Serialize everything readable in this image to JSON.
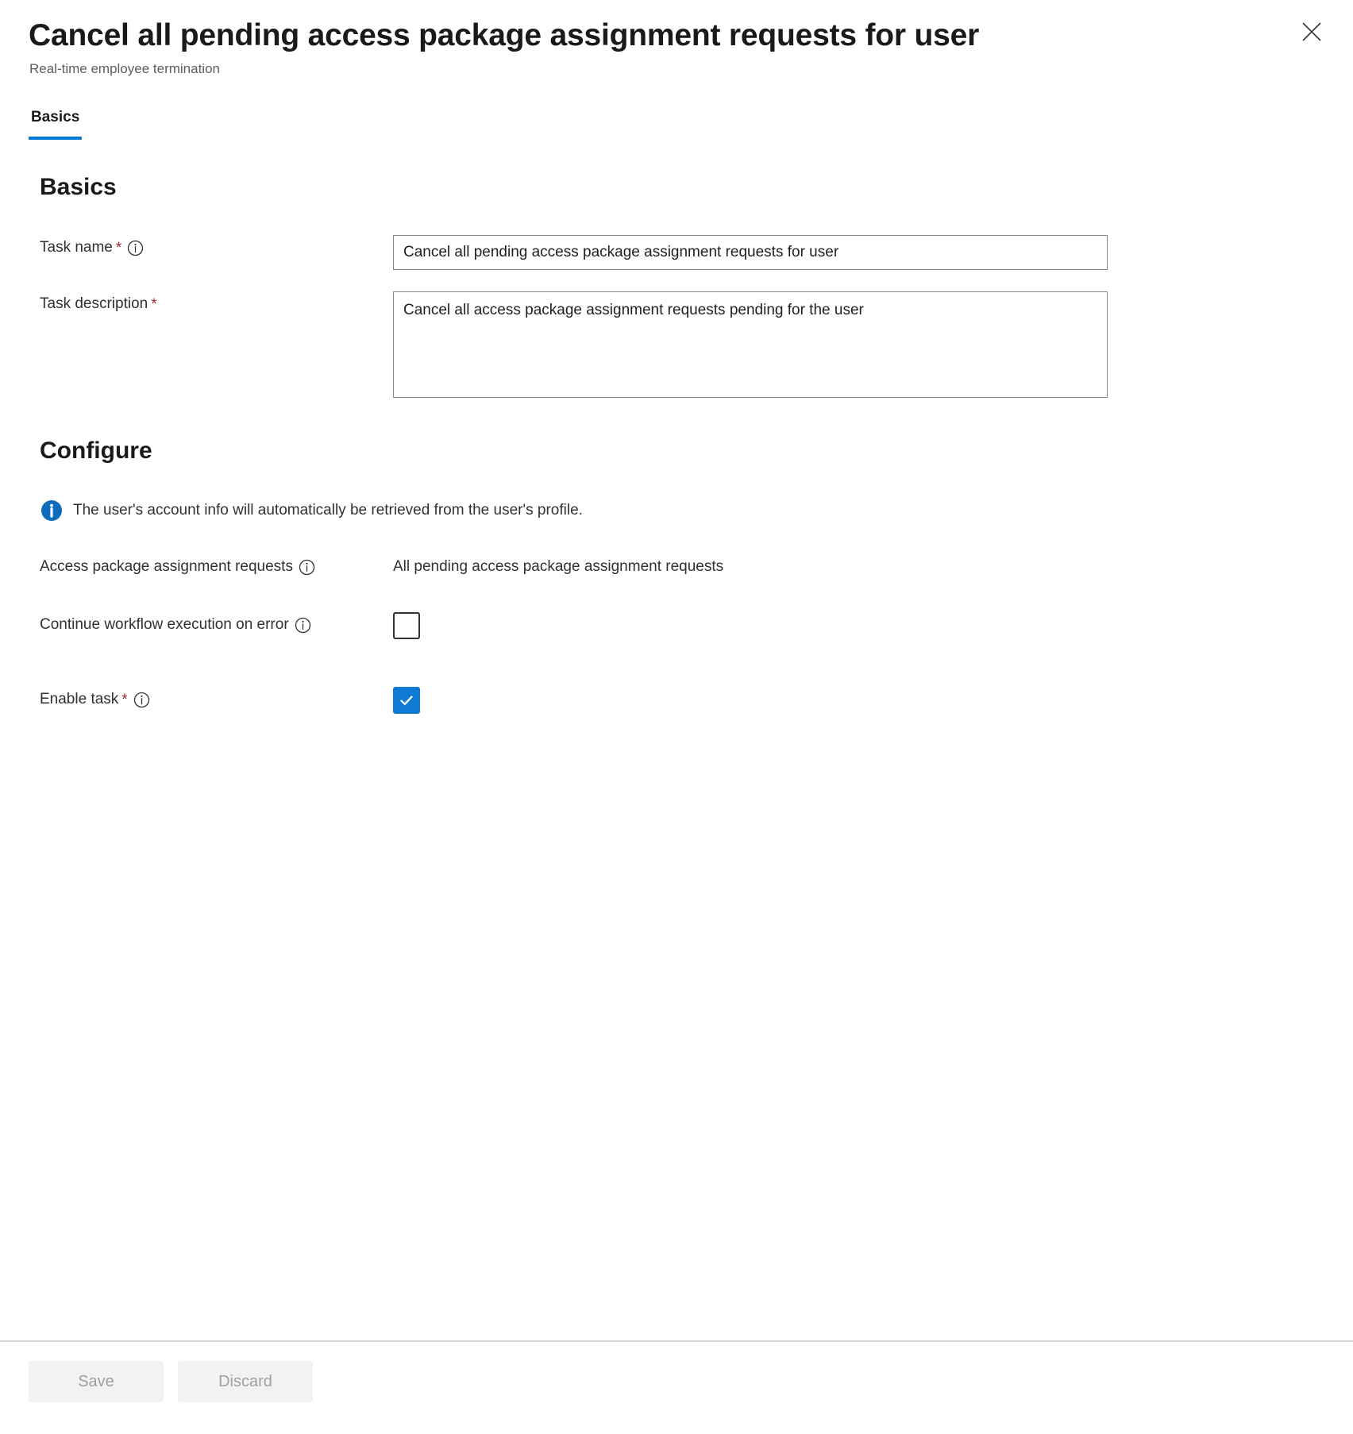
{
  "header": {
    "title": "Cancel all pending access package assignment requests for user",
    "subtitle": "Real-time employee termination",
    "close_icon": "close-icon"
  },
  "tabs": [
    {
      "label": "Basics",
      "selected": true
    }
  ],
  "basics": {
    "heading": "Basics",
    "task_name": {
      "label": "Task name",
      "required_marker": "*",
      "info_icon": "info-circle-icon",
      "value": "Cancel all pending access package assignment requests for user",
      "placeholder": "Task name"
    },
    "task_description": {
      "label": "Task description",
      "required_marker": "*",
      "value": "Cancel all access package assignment requests pending for the user",
      "placeholder": "Task description"
    }
  },
  "configure": {
    "heading": "Configure",
    "info_banner": {
      "icon": "info-filled-icon",
      "text": "The user's account info will automatically be retrieved from the user's profile."
    },
    "access_package_requests": {
      "label": "Access package assignment requests",
      "info_icon": "info-circle-icon",
      "value": "All pending access package assignment requests"
    },
    "continue_on_error": {
      "label": "Continue workflow execution on error",
      "info_icon": "info-circle-icon",
      "checked": false
    },
    "enable_task": {
      "label": "Enable task",
      "required_marker": "*",
      "info_icon": "info-circle-icon",
      "checked": true
    }
  },
  "footer": {
    "save_label": "Save",
    "discard_label": "Discard"
  },
  "colors": {
    "accent": "#0078d4",
    "checkbox_checked": "#0f7ad4",
    "required": "#a4262c",
    "subtitle": "#605e5c",
    "border": "#8a8886"
  }
}
